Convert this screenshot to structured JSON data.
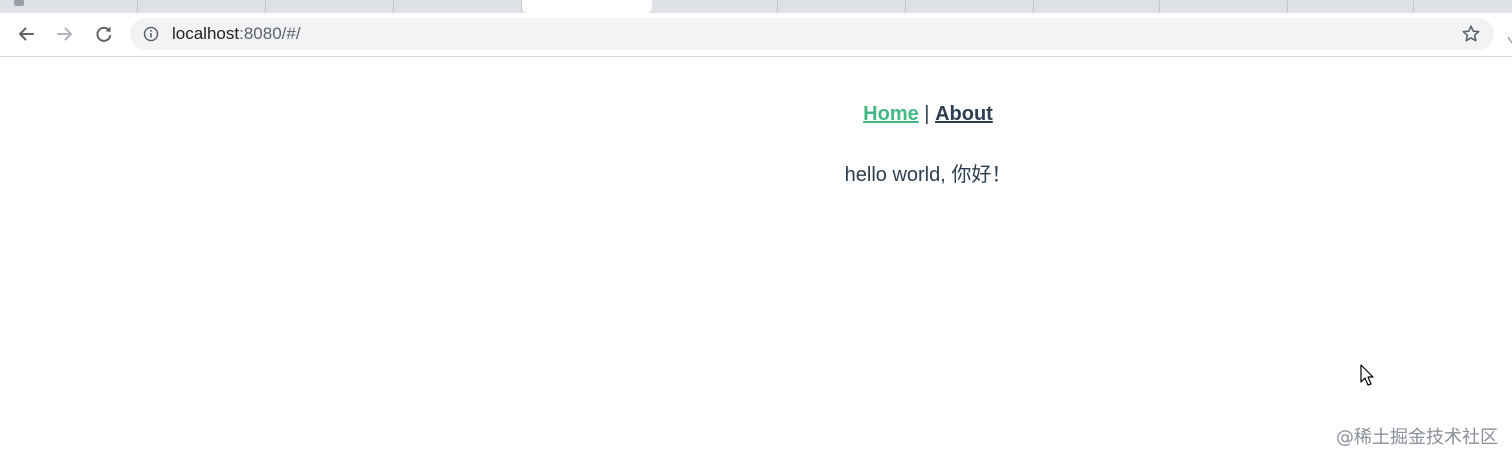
{
  "browser": {
    "address_host": "localhost",
    "address_path": ":8080/#/",
    "icons": {
      "back": "arrow-left-icon",
      "forward": "arrow-right-icon",
      "reload": "reload-icon",
      "site_info": "info-icon",
      "bookmark": "star-icon"
    }
  },
  "page": {
    "nav": {
      "home_label": "Home",
      "separator": " | ",
      "about_label": "About",
      "active": "Home"
    },
    "greeting": "hello world, 你好！"
  },
  "watermark": "@稀土掘金技术社区",
  "colors": {
    "link_active": "#42b983",
    "text": "#2c3e50",
    "toolbar_bg": "#f1f3f4",
    "tabstrip_bg": "#dee1e6"
  }
}
